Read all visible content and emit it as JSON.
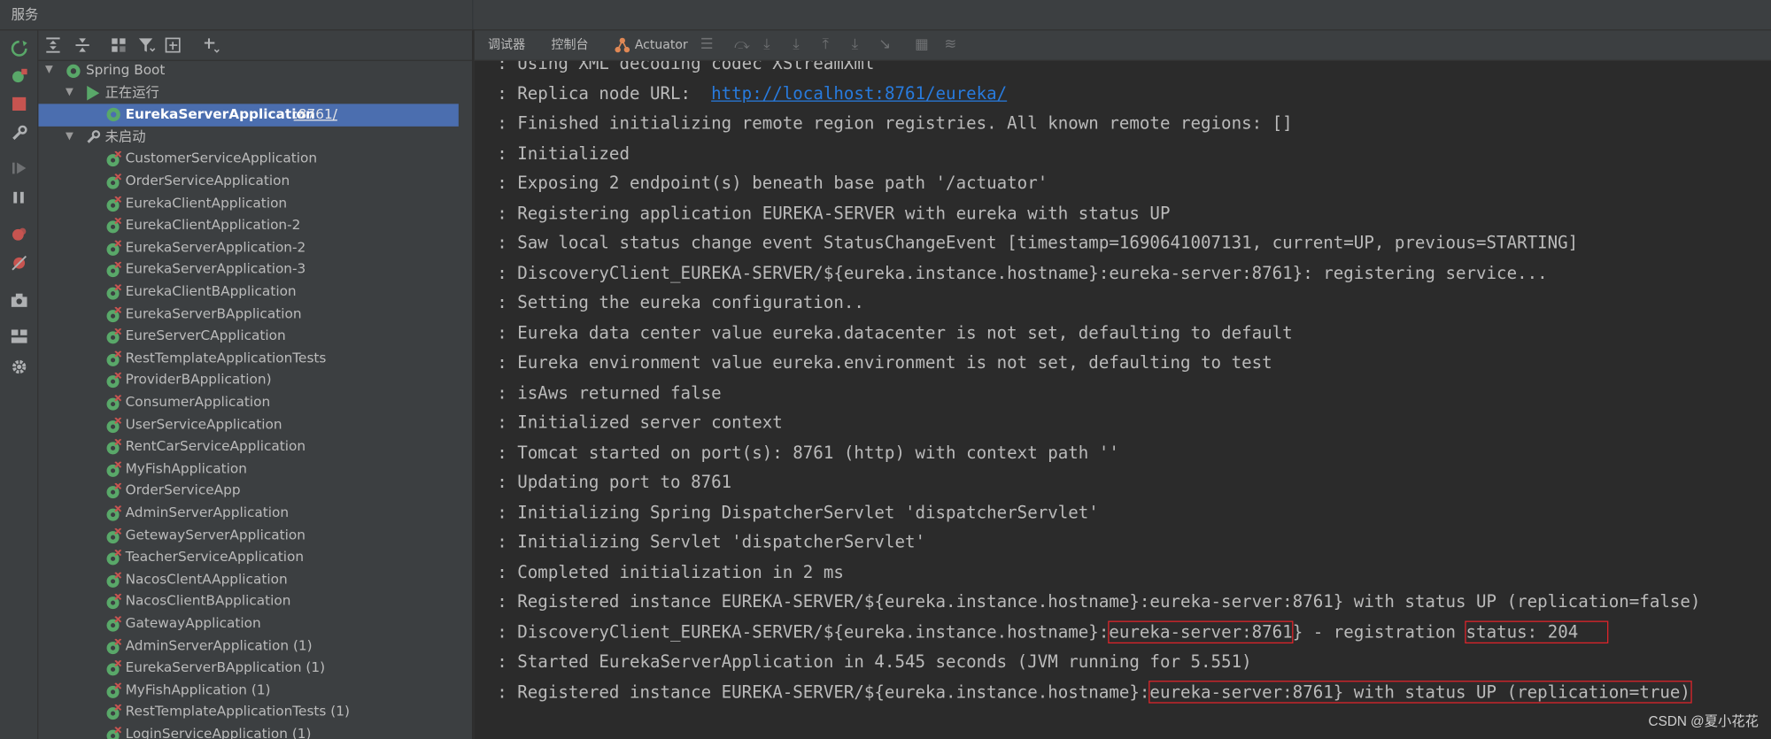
{
  "window": {
    "title": "服务"
  },
  "left_toolbar": {
    "icons": [
      "rerun-icon",
      "debug-config-icon",
      "stop-icon",
      "wrench-icon",
      "resume-icon",
      "pause-icon",
      "breakpoints-icon",
      "mute-breakpoints-icon",
      "camera-icon",
      "layout-icon",
      "settings-icon"
    ]
  },
  "tree_toolbar": {
    "icons": [
      "expand-all-icon",
      "collapse-all-icon",
      "group-by-icon",
      "filter-icon",
      "new-group-icon",
      "add-service-icon"
    ]
  },
  "tree": {
    "root_label": "Spring Boot",
    "running_group": "正在运行",
    "running_app": {
      "name": "EurekaServerApplication",
      "port": ":8761/"
    },
    "stopped_group": "未启动",
    "stopped_apps": [
      "CustomerServiceApplication",
      "OrderServiceApplication",
      "EurekaClientApplication",
      "EurekaClientApplication-2",
      "EurekaServerApplication-2",
      "EurekaServerApplication-3",
      "EurekaClientBApplication",
      "EurekaServerBApplication",
      "EureServerCApplication",
      "RestTemplateApplicationTests",
      "ProviderBApplication)",
      "ConsumerApplication",
      "UserServiceApplication",
      "RentCarServiceApplication",
      "MyFishApplication",
      "OrderServiceApp",
      "AdminServerApplication",
      "GetewayServerApplication",
      "TeacherServiceApplication",
      "NacosClentAApplication",
      "NacosClientBApplication",
      "GatewayApplication",
      "AdminServerApplication (1)",
      "EurekaServerBApplication (1)",
      "MyFishApplication (1)",
      "RestTemplateApplicationTests (1)",
      "LoginServiceApplication (1)"
    ]
  },
  "console_toolbar": {
    "tab_debugger": "调试器",
    "tab_console": "控制台",
    "tab_actuator": "Actuator"
  },
  "console": {
    "lines": [
      ": Using XML decoding codec XStreamXml",
      ": Replica node URL:  ",
      ": Finished initializing remote region registries. All known remote regions: []",
      ": Initialized",
      ": Exposing 2 endpoint(s) beneath base path '/actuator'",
      ": Registering application EUREKA-SERVER with eureka with status UP",
      ": Saw local status change event StatusChangeEvent [timestamp=1690641007131, current=UP, previous=STARTING]",
      ": DiscoveryClient_EUREKA-SERVER/${eureka.instance.hostname}:eureka-server:8761}: registering service...",
      ": Setting the eureka configuration..",
      ": Eureka data center value eureka.datacenter is not set, defaulting to default",
      ": Eureka environment value eureka.environment is not set, defaulting to test",
      ": isAws returned false",
      ": Initialized server context",
      ": Tomcat started on port(s): 8761 (http) with context path ''",
      ": Updating port to 8761",
      ": Initializing Spring DispatcherServlet 'dispatcherServlet'",
      ": Initializing Servlet 'dispatcherServlet'",
      ": Completed initialization in 2 ms",
      ": Registered instance EUREKA-SERVER/${eureka.instance.hostname}:eureka-server:8761} with status UP (replication=false)"
    ],
    "replica_url": "http://localhost:8761/eureka/",
    "line_discovery": {
      "prefix": ": DiscoveryClient_EUREKA-SERVER/${eureka.instance.hostname}:",
      "hl1": "eureka-server:8761",
      "mid": "} - registration ",
      "hl2": "status: 204"
    },
    "line_started": ": Started EurekaServerApplication in 4.545 seconds (JVM running for 5.551)",
    "line_registered_true": {
      "prefix": ": Registered instance EUREKA-SERVER/${eureka.instance.hostname}:",
      "hl": "eureka-server:8761} with status UP (replication=true)"
    }
  },
  "watermark": "CSDN @夏小花花",
  "colors": {
    "selection": "#4b6eaf",
    "highlight_box": "#e0242b",
    "link": "#287bde",
    "run_green": "#59a869",
    "stop_red": "#c75450"
  }
}
